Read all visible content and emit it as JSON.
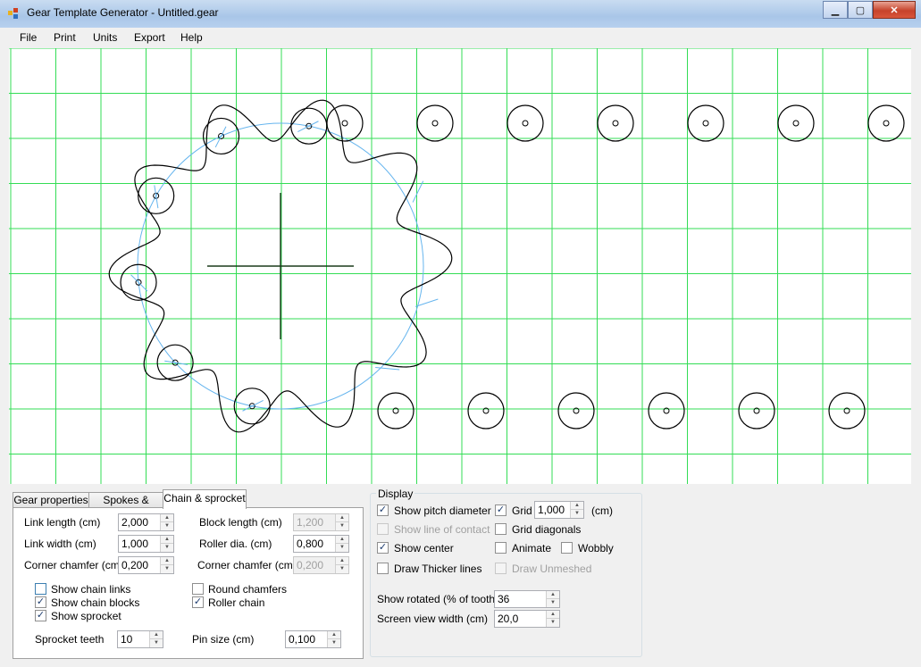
{
  "window": {
    "title": "Gear Template Generator - Untitled.gear",
    "minimize": "▁",
    "restore": "▢",
    "close": "✕"
  },
  "menu": [
    "File",
    "Print",
    "Units",
    "Export",
    "Help"
  ],
  "colors": {
    "grid": "#33dd55",
    "pitch_circle": "#66b5ee",
    "outline": "#000000",
    "accent": "#3c7fb1"
  },
  "tabs": {
    "items": [
      "Gear properties",
      "Spokes & more",
      "Chain & sprocket"
    ],
    "active": "Chain & sprocket"
  },
  "chain": {
    "link_length": {
      "label": "Link length (cm)",
      "value": "2,000"
    },
    "link_width": {
      "label": "Link width (cm)",
      "value": "1,000"
    },
    "corner_chamfer_left": {
      "label": "Corner chamfer (cm)",
      "value": "0,200"
    },
    "block_length": {
      "label": "Block length (cm)",
      "value": "1,200"
    },
    "roller_dia": {
      "label": "Roller dia. (cm)",
      "value": "0,800"
    },
    "corner_chamfer_right": {
      "label": "Corner chamfer (cm)",
      "value": "0,200"
    },
    "show_chain_links": {
      "label": "Show chain links",
      "checked": false
    },
    "show_chain_blocks": {
      "label": "Show chain blocks",
      "checked": true
    },
    "show_sprocket": {
      "label": "Show sprocket",
      "checked": true
    },
    "round_chamfers": {
      "label": "Round chamfers",
      "checked": false
    },
    "roller_chain": {
      "label": "Roller chain",
      "checked": true
    },
    "sprocket_teeth": {
      "label": "Sprocket teeth",
      "value": "10"
    },
    "pin_size": {
      "label": "Pin size (cm)",
      "value": "0,100"
    }
  },
  "display": {
    "legend": "Display",
    "show_pitch_diameter": {
      "label": "Show pitch diameter",
      "checked": true
    },
    "show_line_of_contact": {
      "label": "Show line of contact",
      "checked": false
    },
    "show_center": {
      "label": "Show center",
      "checked": true
    },
    "draw_thicker_lines": {
      "label": "Draw Thicker lines",
      "checked": false
    },
    "grid": {
      "label": "Grid",
      "checked": true,
      "value": "1,000",
      "unit": "(cm)"
    },
    "grid_diagonals": {
      "label": "Grid diagonals",
      "checked": false
    },
    "animate": {
      "label": "Animate",
      "checked": false
    },
    "wobbly": {
      "label": "Wobbly",
      "checked": false
    },
    "draw_unmeshed": {
      "label": "Draw Unmeshed",
      "checked": false
    },
    "show_rotated": {
      "label": "Show rotated (% of tooth)",
      "value": "36"
    },
    "screen_view_width": {
      "label": "Screen view width (cm)",
      "value": "20,0"
    }
  }
}
